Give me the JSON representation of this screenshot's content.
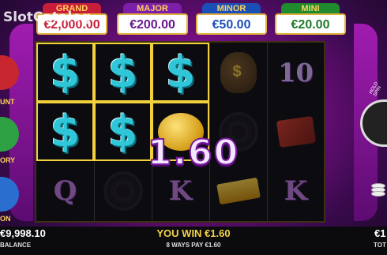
{
  "watermark": "SlotCatalog",
  "jackpots": [
    {
      "label": "GRAND",
      "value": "€2,000.00"
    },
    {
      "label": "MAJOR",
      "value": "€200.00"
    },
    {
      "label": "MINOR",
      "value": "€50.00"
    },
    {
      "label": "MINI",
      "value": "€20.00"
    }
  ],
  "reels": [
    [
      "$",
      "$",
      "Q"
    ],
    [
      "$",
      "$",
      ""
    ],
    [
      "$",
      "",
      "K"
    ],
    [
      "",
      "",
      ""
    ],
    [
      "10",
      "",
      "K"
    ]
  ],
  "side_labels": [
    "UNT",
    "ORY",
    "ON"
  ],
  "hold_spin_label": "HOLD SPIN",
  "win_amount": "1.60",
  "footer": {
    "balance_value": "€9,998.10",
    "balance_label": "BALANCE",
    "you_win": "YOU WIN €1.60",
    "ways_pay": "8 WAYS PAY €1.60",
    "right_value": "€1",
    "right_label": "TOT"
  },
  "colors": {
    "accent_gold": "#f3d24a",
    "dollar_cyan": "#2fc7d8",
    "background_magenta": "#c21ba8"
  }
}
